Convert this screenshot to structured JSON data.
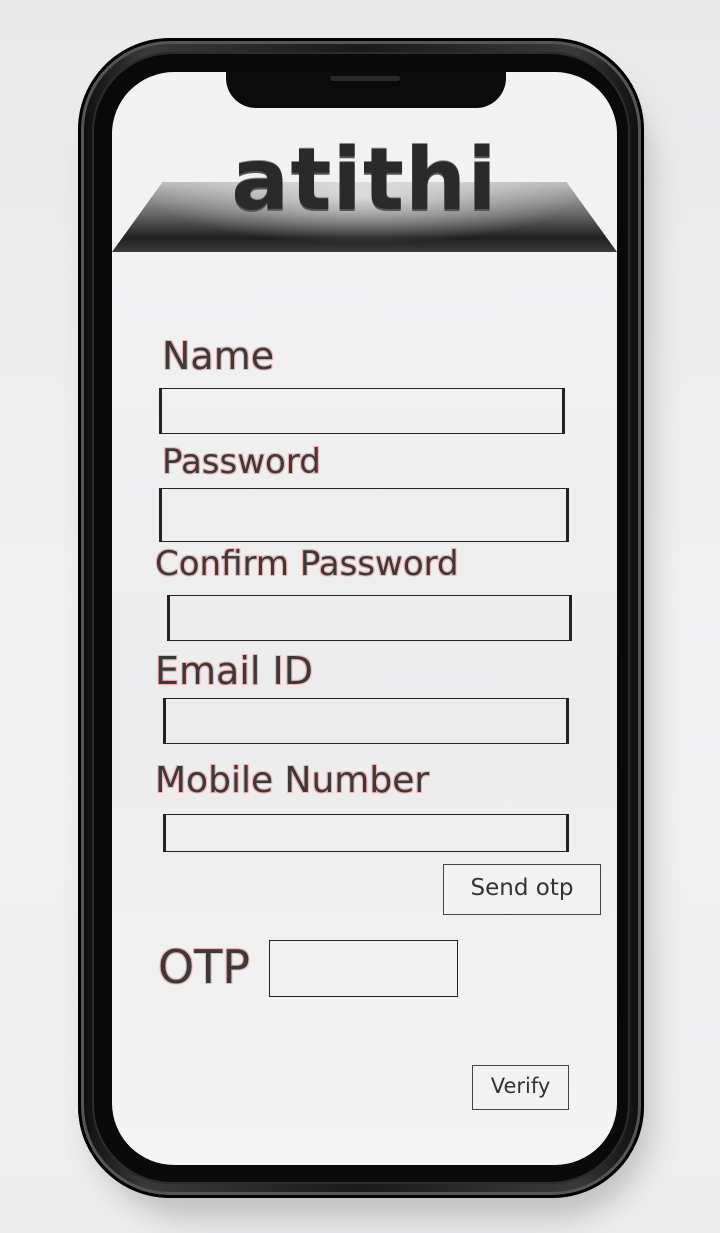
{
  "app": {
    "logo_text": "atithi"
  },
  "form": {
    "name_label": "Name",
    "password_label": "Password",
    "confirm_password_label": "Confirm Password",
    "email_label": "Email ID",
    "mobile_label": "Mobile Number",
    "otp_label": "OTP",
    "name_value": "",
    "password_value": "",
    "confirm_password_value": "",
    "email_value": "",
    "mobile_value": "",
    "otp_value": ""
  },
  "buttons": {
    "send_otp": "Send otp",
    "verify": "Verify"
  },
  "colors": {
    "label_text": "#3a3a3a",
    "label_glow": "#f0b4b4",
    "phone_frame": "#1a1a1a",
    "screen_bg": "#efeff0"
  },
  "icons": {
    "notch": "notch-speaker-icon"
  }
}
